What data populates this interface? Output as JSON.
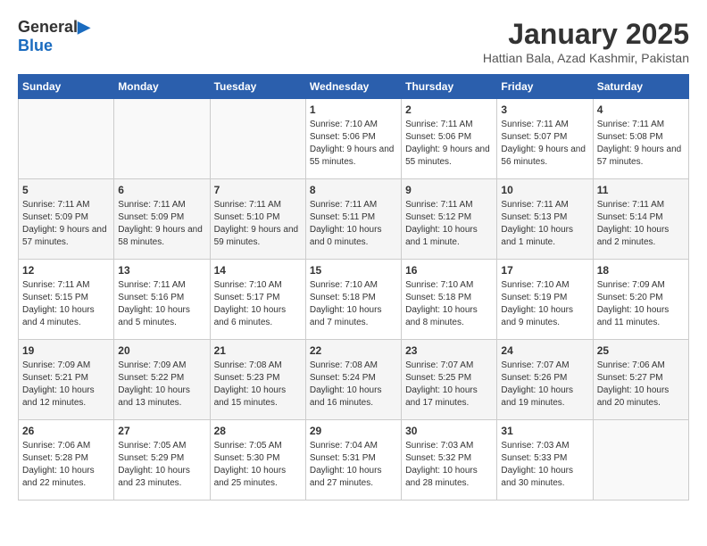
{
  "header": {
    "logo_line1": "General",
    "logo_line2": "Blue",
    "month": "January 2025",
    "location": "Hattian Bala, Azad Kashmir, Pakistan"
  },
  "days_of_week": [
    "Sunday",
    "Monday",
    "Tuesday",
    "Wednesday",
    "Thursday",
    "Friday",
    "Saturday"
  ],
  "weeks": [
    [
      {
        "day": "",
        "sunrise": "",
        "sunset": "",
        "daylight": ""
      },
      {
        "day": "",
        "sunrise": "",
        "sunset": "",
        "daylight": ""
      },
      {
        "day": "",
        "sunrise": "",
        "sunset": "",
        "daylight": ""
      },
      {
        "day": "1",
        "sunrise": "Sunrise: 7:10 AM",
        "sunset": "Sunset: 5:06 PM",
        "daylight": "Daylight: 9 hours and 55 minutes."
      },
      {
        "day": "2",
        "sunrise": "Sunrise: 7:11 AM",
        "sunset": "Sunset: 5:06 PM",
        "daylight": "Daylight: 9 hours and 55 minutes."
      },
      {
        "day": "3",
        "sunrise": "Sunrise: 7:11 AM",
        "sunset": "Sunset: 5:07 PM",
        "daylight": "Daylight: 9 hours and 56 minutes."
      },
      {
        "day": "4",
        "sunrise": "Sunrise: 7:11 AM",
        "sunset": "Sunset: 5:08 PM",
        "daylight": "Daylight: 9 hours and 57 minutes."
      }
    ],
    [
      {
        "day": "5",
        "sunrise": "Sunrise: 7:11 AM",
        "sunset": "Sunset: 5:09 PM",
        "daylight": "Daylight: 9 hours and 57 minutes."
      },
      {
        "day": "6",
        "sunrise": "Sunrise: 7:11 AM",
        "sunset": "Sunset: 5:09 PM",
        "daylight": "Daylight: 9 hours and 58 minutes."
      },
      {
        "day": "7",
        "sunrise": "Sunrise: 7:11 AM",
        "sunset": "Sunset: 5:10 PM",
        "daylight": "Daylight: 9 hours and 59 minutes."
      },
      {
        "day": "8",
        "sunrise": "Sunrise: 7:11 AM",
        "sunset": "Sunset: 5:11 PM",
        "daylight": "Daylight: 10 hours and 0 minutes."
      },
      {
        "day": "9",
        "sunrise": "Sunrise: 7:11 AM",
        "sunset": "Sunset: 5:12 PM",
        "daylight": "Daylight: 10 hours and 1 minute."
      },
      {
        "day": "10",
        "sunrise": "Sunrise: 7:11 AM",
        "sunset": "Sunset: 5:13 PM",
        "daylight": "Daylight: 10 hours and 1 minute."
      },
      {
        "day": "11",
        "sunrise": "Sunrise: 7:11 AM",
        "sunset": "Sunset: 5:14 PM",
        "daylight": "Daylight: 10 hours and 2 minutes."
      }
    ],
    [
      {
        "day": "12",
        "sunrise": "Sunrise: 7:11 AM",
        "sunset": "Sunset: 5:15 PM",
        "daylight": "Daylight: 10 hours and 4 minutes."
      },
      {
        "day": "13",
        "sunrise": "Sunrise: 7:11 AM",
        "sunset": "Sunset: 5:16 PM",
        "daylight": "Daylight: 10 hours and 5 minutes."
      },
      {
        "day": "14",
        "sunrise": "Sunrise: 7:10 AM",
        "sunset": "Sunset: 5:17 PM",
        "daylight": "Daylight: 10 hours and 6 minutes."
      },
      {
        "day": "15",
        "sunrise": "Sunrise: 7:10 AM",
        "sunset": "Sunset: 5:18 PM",
        "daylight": "Daylight: 10 hours and 7 minutes."
      },
      {
        "day": "16",
        "sunrise": "Sunrise: 7:10 AM",
        "sunset": "Sunset: 5:18 PM",
        "daylight": "Daylight: 10 hours and 8 minutes."
      },
      {
        "day": "17",
        "sunrise": "Sunrise: 7:10 AM",
        "sunset": "Sunset: 5:19 PM",
        "daylight": "Daylight: 10 hours and 9 minutes."
      },
      {
        "day": "18",
        "sunrise": "Sunrise: 7:09 AM",
        "sunset": "Sunset: 5:20 PM",
        "daylight": "Daylight: 10 hours and 11 minutes."
      }
    ],
    [
      {
        "day": "19",
        "sunrise": "Sunrise: 7:09 AM",
        "sunset": "Sunset: 5:21 PM",
        "daylight": "Daylight: 10 hours and 12 minutes."
      },
      {
        "day": "20",
        "sunrise": "Sunrise: 7:09 AM",
        "sunset": "Sunset: 5:22 PM",
        "daylight": "Daylight: 10 hours and 13 minutes."
      },
      {
        "day": "21",
        "sunrise": "Sunrise: 7:08 AM",
        "sunset": "Sunset: 5:23 PM",
        "daylight": "Daylight: 10 hours and 15 minutes."
      },
      {
        "day": "22",
        "sunrise": "Sunrise: 7:08 AM",
        "sunset": "Sunset: 5:24 PM",
        "daylight": "Daylight: 10 hours and 16 minutes."
      },
      {
        "day": "23",
        "sunrise": "Sunrise: 7:07 AM",
        "sunset": "Sunset: 5:25 PM",
        "daylight": "Daylight: 10 hours and 17 minutes."
      },
      {
        "day": "24",
        "sunrise": "Sunrise: 7:07 AM",
        "sunset": "Sunset: 5:26 PM",
        "daylight": "Daylight: 10 hours and 19 minutes."
      },
      {
        "day": "25",
        "sunrise": "Sunrise: 7:06 AM",
        "sunset": "Sunset: 5:27 PM",
        "daylight": "Daylight: 10 hours and 20 minutes."
      }
    ],
    [
      {
        "day": "26",
        "sunrise": "Sunrise: 7:06 AM",
        "sunset": "Sunset: 5:28 PM",
        "daylight": "Daylight: 10 hours and 22 minutes."
      },
      {
        "day": "27",
        "sunrise": "Sunrise: 7:05 AM",
        "sunset": "Sunset: 5:29 PM",
        "daylight": "Daylight: 10 hours and 23 minutes."
      },
      {
        "day": "28",
        "sunrise": "Sunrise: 7:05 AM",
        "sunset": "Sunset: 5:30 PM",
        "daylight": "Daylight: 10 hours and 25 minutes."
      },
      {
        "day": "29",
        "sunrise": "Sunrise: 7:04 AM",
        "sunset": "Sunset: 5:31 PM",
        "daylight": "Daylight: 10 hours and 27 minutes."
      },
      {
        "day": "30",
        "sunrise": "Sunrise: 7:03 AM",
        "sunset": "Sunset: 5:32 PM",
        "daylight": "Daylight: 10 hours and 28 minutes."
      },
      {
        "day": "31",
        "sunrise": "Sunrise: 7:03 AM",
        "sunset": "Sunset: 5:33 PM",
        "daylight": "Daylight: 10 hours and 30 minutes."
      },
      {
        "day": "",
        "sunrise": "",
        "sunset": "",
        "daylight": ""
      }
    ]
  ]
}
